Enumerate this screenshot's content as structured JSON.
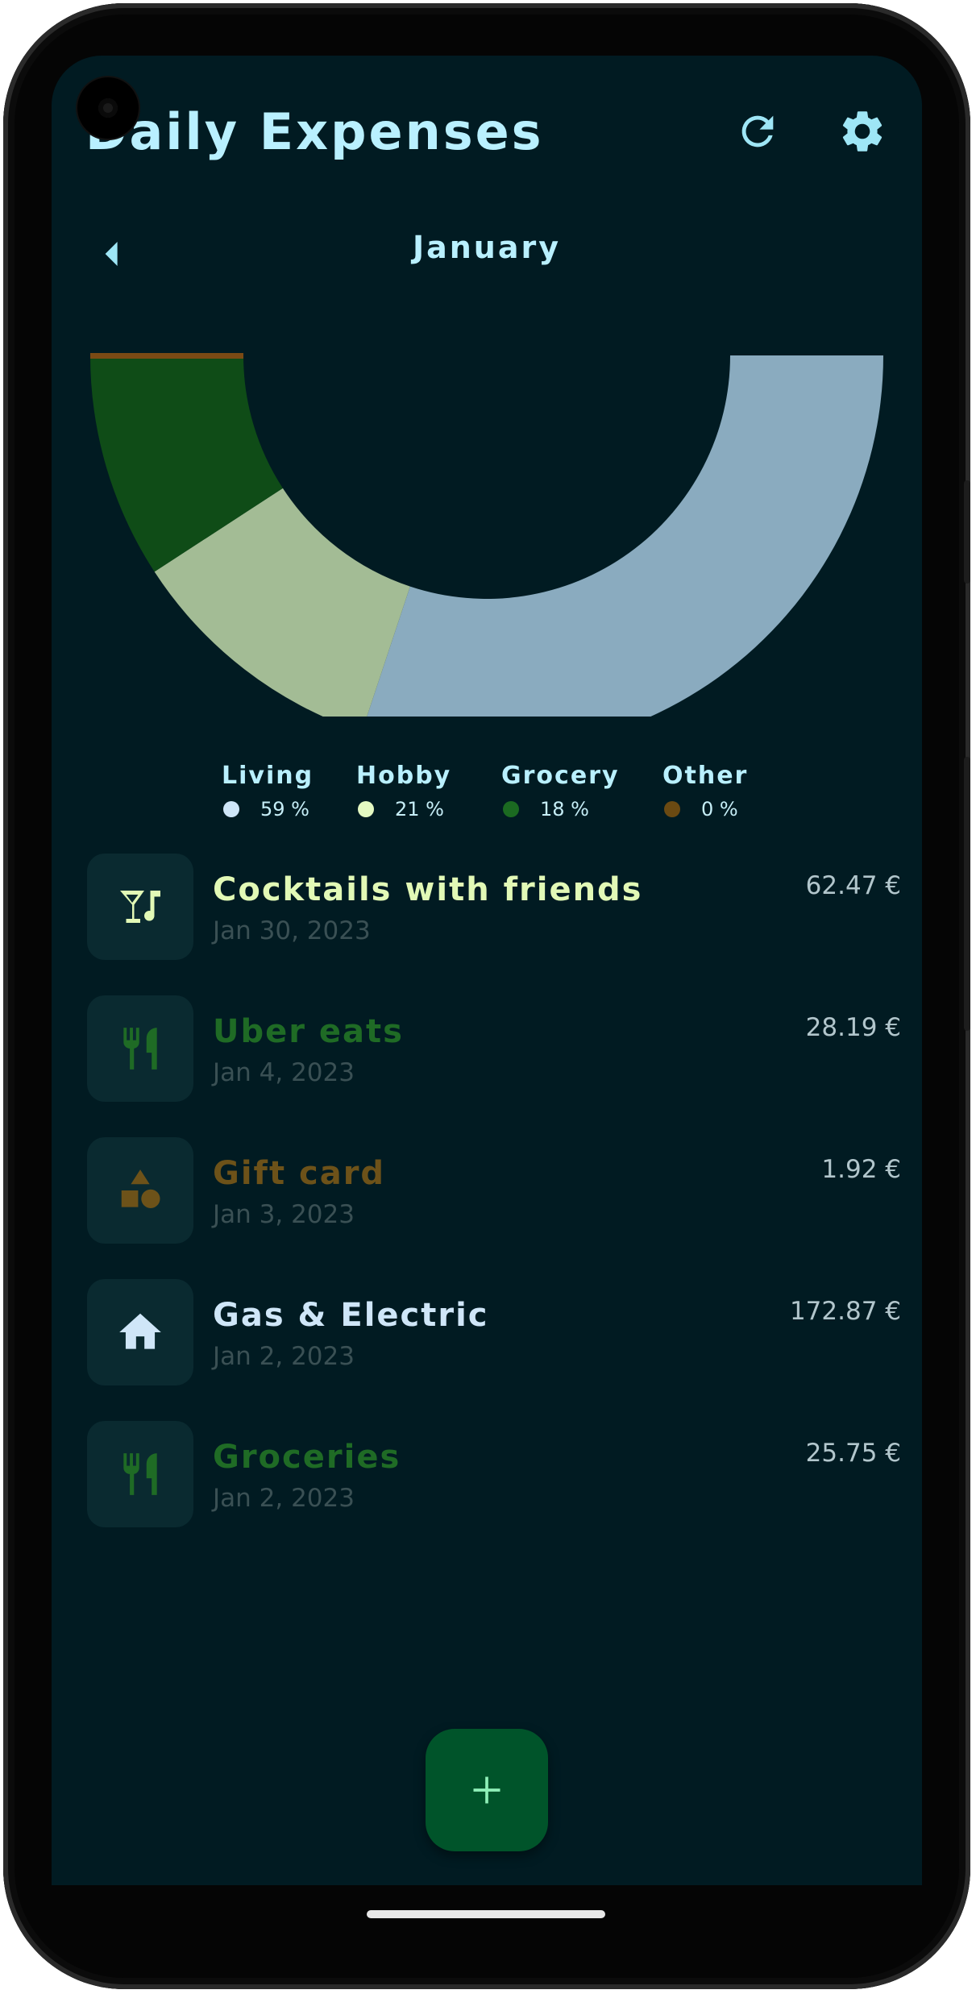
{
  "app": {
    "title": "Daily Expenses",
    "month": "January"
  },
  "icons": {
    "refresh": "refresh-icon",
    "settings": "gear-icon",
    "back": "chevron-left-icon",
    "add": "plus-icon"
  },
  "chart_data": {
    "type": "pie",
    "style": "half-donut",
    "categories": [
      "Living",
      "Hobby",
      "Grocery",
      "Other"
    ],
    "values": [
      59,
      21,
      18,
      0
    ],
    "colors": [
      "#8aabbf",
      "#a3bc95",
      "#0f4c17",
      "#7a4a14"
    ]
  },
  "legend": [
    {
      "name": "Living",
      "pct": "59 %",
      "color": "#cfe6f8"
    },
    {
      "name": "Hobby",
      "pct": "21 %",
      "color": "#e4f9c2"
    },
    {
      "name": "Grocery",
      "pct": "18 %",
      "color": "#1b6a21"
    },
    {
      "name": "Other",
      "pct": "0 %",
      "color": "#6b4a12"
    }
  ],
  "expenses": [
    {
      "title": "Cocktails with friends",
      "date": "Jan 30, 2023",
      "amount": "62.47 €",
      "color": "#e2f9b6",
      "icon": "cocktail-icon"
    },
    {
      "title": "Uber eats",
      "date": "Jan 4, 2023",
      "amount": "28.19 €",
      "color": "#1f6b25",
      "icon": "restaurant-icon"
    },
    {
      "title": "Gift card",
      "date": "Jan 3, 2023",
      "amount": "1.92 €",
      "color": "#6d5219",
      "icon": "shapes-icon"
    },
    {
      "title": "Gas & Electric",
      "date": "Jan 2, 2023",
      "amount": "172.87 €",
      "color": "#cfe6f8",
      "icon": "home-icon"
    },
    {
      "title": "Groceries",
      "date": "Jan 2, 2023",
      "amount": "25.75 €",
      "color": "#1f6b25",
      "icon": "restaurant-icon"
    }
  ]
}
